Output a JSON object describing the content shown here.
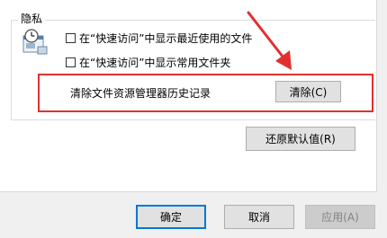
{
  "privacy_group": {
    "title": "隐私",
    "checkbox_recent_files": {
      "label": "在“快速访问”中显示最近使用的文件",
      "checked": false
    },
    "checkbox_frequent_folders": {
      "label": "在“快速访问”中显示常用文件夹",
      "checked": false
    },
    "clear_history_label": "清除文件资源管理器历史记录",
    "clear_button_label": "清除(C)"
  },
  "restore_defaults_label": "还原默认值(R)",
  "footer": {
    "ok_label": "确定",
    "cancel_label": "取消",
    "apply_label": "应用(A)",
    "apply_enabled": false
  },
  "colors": {
    "annotation_red": "#e03030",
    "focus_blue": "#0078d7"
  },
  "icons": {
    "privacy": "privacy-clock-window-icon",
    "annotation": "red-arrow-icon"
  }
}
